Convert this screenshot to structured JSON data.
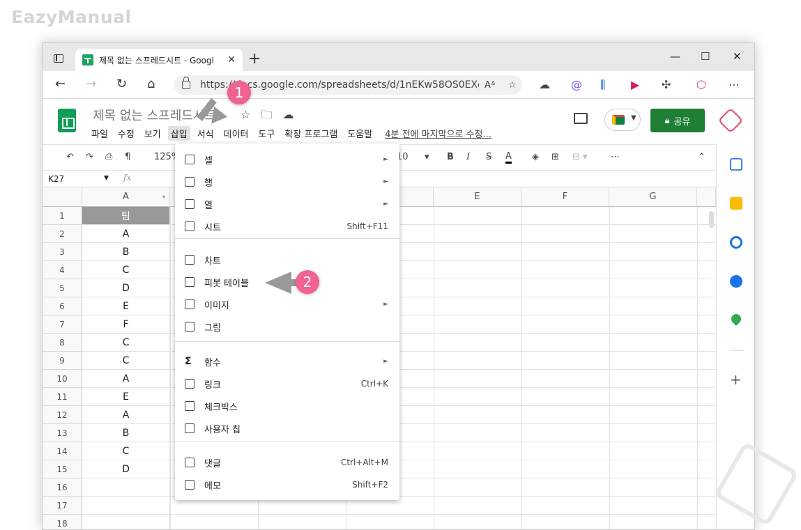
{
  "watermark": "EazyManual",
  "browser": {
    "tab_title": "제목 없는 스프레드시트 - Googl",
    "url": "https://docs.google.com/spreadsheets/d/1nEKw58OS0EXgi...",
    "read_aloud": "A͇"
  },
  "sheets": {
    "doc_title": "제목 없는 스프레드시트",
    "menus": [
      "파일",
      "수정",
      "보기",
      "삽입",
      "서식",
      "데이터",
      "도구",
      "확장 프로그램",
      "도움말"
    ],
    "last_edit": "4분 전에 마지막으로 수정...",
    "share_label": "공유",
    "zoom": "125%",
    "font_size": "10",
    "name_box": "K27",
    "fx": "fx",
    "columns": [
      "A",
      "E",
      "F",
      "G"
    ],
    "rows": [
      "1",
      "2",
      "3",
      "4",
      "5",
      "6",
      "7",
      "8",
      "9",
      "10",
      "11",
      "12",
      "13",
      "14",
      "15",
      "16",
      "17",
      "18"
    ],
    "col_a_values": [
      "팀",
      "A",
      "B",
      "C",
      "D",
      "E",
      "F",
      "C",
      "C",
      "A",
      "E",
      "A",
      "B",
      "C",
      "D",
      "",
      "",
      ""
    ]
  },
  "insert_menu": {
    "items": [
      {
        "label": "셀",
        "shortcut": "",
        "submenu": true
      },
      {
        "label": "행",
        "shortcut": "",
        "submenu": true
      },
      {
        "label": "열",
        "shortcut": "",
        "submenu": true
      },
      {
        "label": "시트",
        "shortcut": "Shift+F11",
        "submenu": false
      },
      {
        "label": "차트",
        "shortcut": "",
        "submenu": false
      },
      {
        "label": "피봇 테이블",
        "shortcut": "",
        "submenu": false
      },
      {
        "label": "이미지",
        "shortcut": "",
        "submenu": true
      },
      {
        "label": "그림",
        "shortcut": "",
        "submenu": false
      },
      {
        "label": "함수",
        "shortcut": "",
        "submenu": true
      },
      {
        "label": "링크",
        "shortcut": "Ctrl+K",
        "submenu": false
      },
      {
        "label": "체크박스",
        "shortcut": "",
        "submenu": false
      },
      {
        "label": "사용자 칩",
        "shortcut": "",
        "submenu": false
      },
      {
        "label": "댓글",
        "shortcut": "Ctrl+Alt+M",
        "submenu": false
      },
      {
        "label": "메모",
        "shortcut": "Shift+F2",
        "submenu": false
      }
    ]
  },
  "badges": {
    "step1": "1",
    "step2": "2"
  },
  "colors": {
    "share_green": "#1e7e34",
    "sheets_green": "#0f9d58",
    "badge_pink": "#f06292"
  }
}
